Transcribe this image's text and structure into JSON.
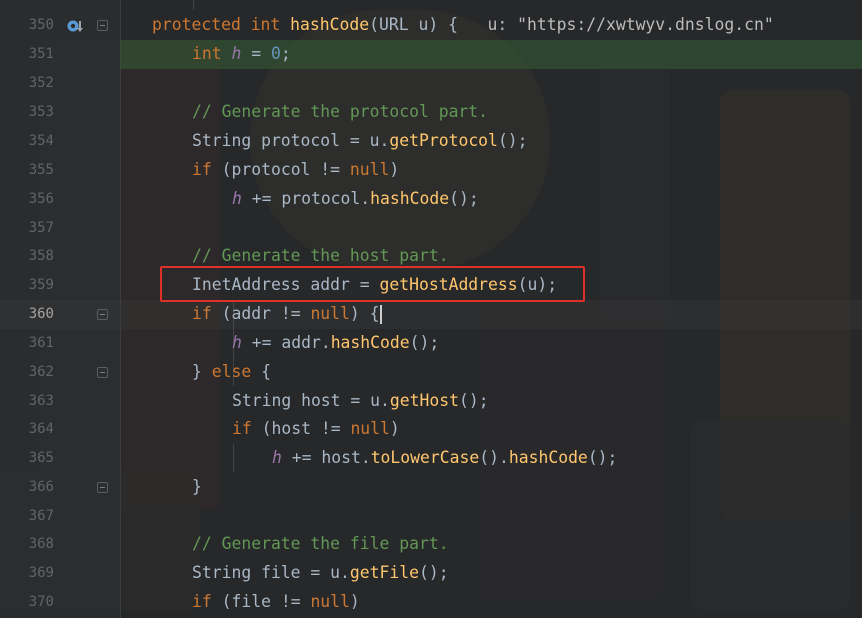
{
  "lines": [
    {
      "num": "350"
    },
    {
      "num": "351"
    },
    {
      "num": "352"
    },
    {
      "num": "353"
    },
    {
      "num": "354"
    },
    {
      "num": "355"
    },
    {
      "num": "356"
    },
    {
      "num": "357"
    },
    {
      "num": "358"
    },
    {
      "num": "359"
    },
    {
      "num": "360"
    },
    {
      "num": "361"
    },
    {
      "num": "362"
    },
    {
      "num": "363"
    },
    {
      "num": "364"
    },
    {
      "num": "365"
    },
    {
      "num": "366"
    },
    {
      "num": "367"
    },
    {
      "num": "368"
    },
    {
      "num": "369"
    },
    {
      "num": "370"
    }
  ],
  "code": {
    "l350": {
      "kw1": "protected",
      "kw2": "int",
      "fn": "hashCode",
      "rest": "(URL u) {",
      "hint": "u: \"https://xwtwyv.dnslog.cn\""
    },
    "l351": {
      "kw": "int",
      "var": "h",
      "eq": " = ",
      "num": "0",
      "end": ";"
    },
    "l353": {
      "comment": "// Generate the protocol part."
    },
    "l354": {
      "pre": "String protocol = u.",
      "fn": "getProtocol",
      "end": "();"
    },
    "l355": {
      "kw": "if",
      "pre": " (protocol != ",
      "kw2": "null",
      "end": ")"
    },
    "l356": {
      "var": "h",
      "pre": " += protocol.",
      "fn": "hashCode",
      "end": "();"
    },
    "l358": {
      "comment": "// Generate the host part."
    },
    "l359": {
      "pre": "InetAddress addr = ",
      "fn": "getHostAddress",
      "end": "(u);"
    },
    "l360": {
      "kw": "if",
      "pre": " (addr != ",
      "kw2": "null",
      "end": ") {"
    },
    "l361": {
      "var": "h",
      "pre": " += addr.",
      "fn": "hashCode",
      "end": "();"
    },
    "l362": {
      "pre": "} ",
      "kw": "else",
      "end": " {"
    },
    "l363": {
      "pre": "String host = u.",
      "fn": "getHost",
      "end": "();"
    },
    "l364": {
      "kw": "if",
      "pre": " (host != ",
      "kw2": "null",
      "end": ")"
    },
    "l365": {
      "var": "h",
      "pre": " += host.",
      "fn": "toLowerCase",
      "mid": "().",
      "fn2": "hashCode",
      "end": "();"
    },
    "l366": {
      "pre": "}"
    },
    "l368": {
      "comment": "// Generate the file part."
    },
    "l369": {
      "pre": "String file = u.",
      "fn": "getFile",
      "end": "();"
    },
    "l370": {
      "kw": "if",
      "pre": " (file != ",
      "kw2": "null",
      "end": ")"
    }
  },
  "colors": {
    "keyword": "#cc7832",
    "function": "#ffc66d",
    "comment": "#629755",
    "number": "#6897bb",
    "highlight_box": "#e0302a"
  },
  "icons": {
    "gutter_350": "breakpoint-override-icon"
  }
}
